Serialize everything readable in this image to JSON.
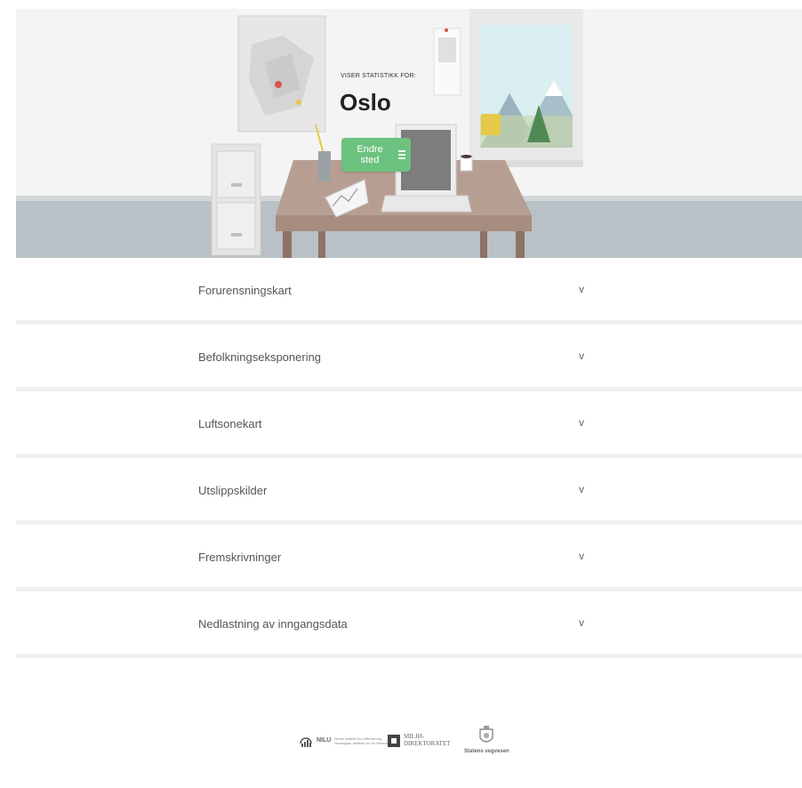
{
  "hero": {
    "caption": "VISER STATISTIKK FOR:",
    "city": "Oslo",
    "change_button_label": "Endre sted"
  },
  "sections": [
    {
      "label": "Forurensningskart"
    },
    {
      "label": "Befolkningseksponering"
    },
    {
      "label": "Luftsonekart"
    },
    {
      "label": "Utslippskilder"
    },
    {
      "label": "Fremskrivninger"
    },
    {
      "label": "Nedlastning av inngangsdata"
    }
  ],
  "chevron": "v",
  "footer": {
    "nilu": {
      "name": "NILU",
      "line1": "Norsk institutt for luftforskning",
      "line2": "Norwegian Institute for Air Research"
    },
    "miljo": {
      "line1": "MILJØ-",
      "line2": "DIREKTORATET"
    },
    "vegvesen": {
      "name": "Statens vegvesen"
    }
  },
  "colors": {
    "accent": "#6cc27f",
    "divider": "#f0f0f0",
    "floor": "#b7bec3"
  }
}
